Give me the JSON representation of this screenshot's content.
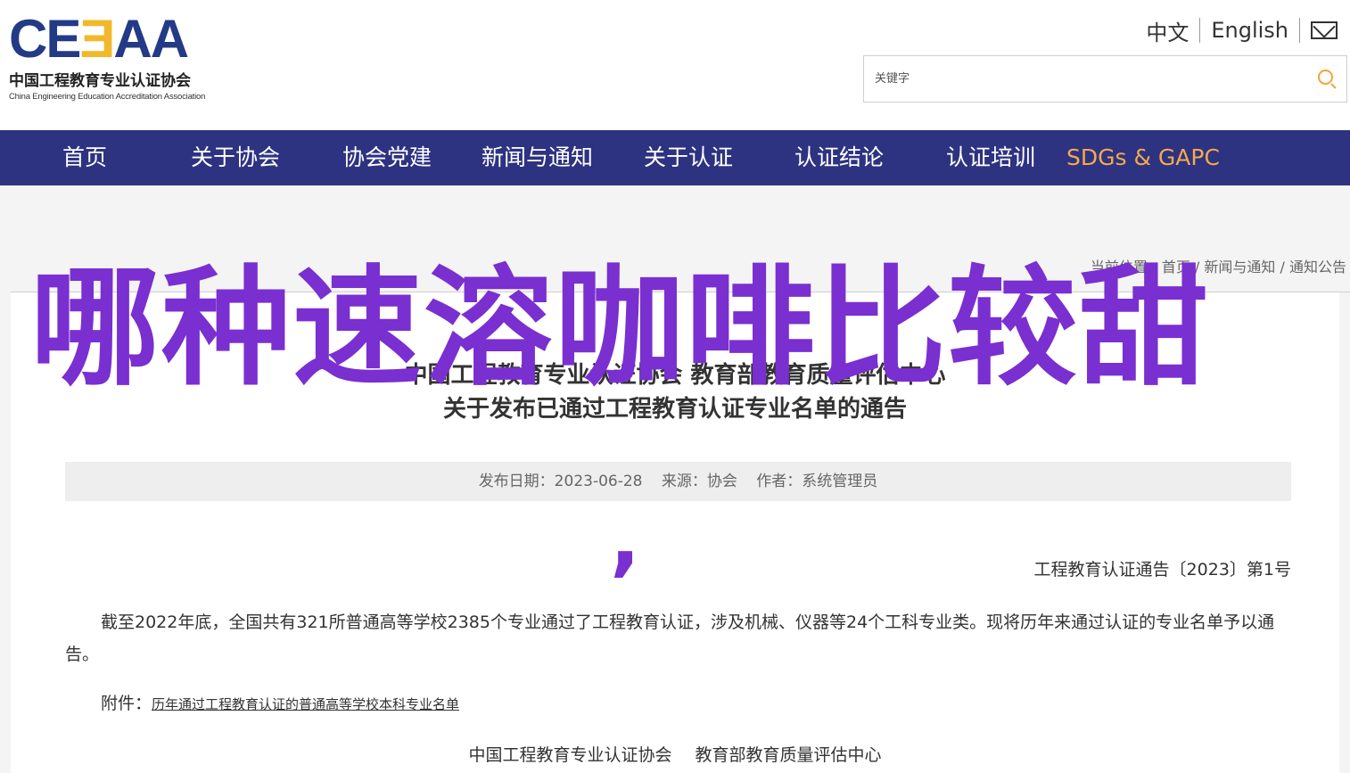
{
  "logo": {
    "mark_a": "CE",
    "mark_b": "Ǝ",
    "mark_c": "AA",
    "cn_name": "中国工程教育专业认证协会",
    "en_name": "China Engineering Education Accreditation Association"
  },
  "lang": {
    "zh": "中文",
    "en": "English",
    "mail_icon": "mail-icon"
  },
  "search": {
    "placeholder": "关键字",
    "value": "",
    "icon": "search-icon"
  },
  "nav": {
    "items": [
      {
        "label": "首页"
      },
      {
        "label": "关于协会"
      },
      {
        "label": "协会党建"
      },
      {
        "label": "新闻与通知"
      },
      {
        "label": "关于认证"
      },
      {
        "label": "认证结论"
      },
      {
        "label": "认证培训"
      },
      {
        "label": "SDGs & GAPC"
      }
    ],
    "highlight_color": "#f4a94e",
    "bg_color": "#2d3381"
  },
  "breadcrumb": {
    "prefix": "当前位置：",
    "items": [
      "首页",
      "新闻与通知",
      "通知公告"
    ],
    "separator": " / "
  },
  "overlay_text": "哪种速溶咖啡比较甜",
  "overlay_color": "#7a2fd0",
  "article": {
    "title_line1": "中国工程教育专业认证协会 教育部教育质量评估中心",
    "title_line2": "关于发布已通过工程教育认证专业名单的通告",
    "meta": {
      "date": "发布日期：2023-06-28",
      "source": "来源：协会",
      "author": "作者：系统管理员"
    },
    "stray_glyph": ",",
    "doc_number": "工程教育认证通告〔2023〕第1号",
    "paragraph": "截至2022年底，全国共有321所普通高等学校2385个专业通过了工程教育认证，涉及机械、仪器等24个工科专业类。现将历年来通过认证的专业名单予以通告。",
    "attachment_label": "附件：",
    "attachment_link": "历年通过工程教育认证的普通高等学校本科专业名单",
    "signature_1": "中国工程教育专业认证协会",
    "signature_2": "教育部教育质量评估中心"
  }
}
